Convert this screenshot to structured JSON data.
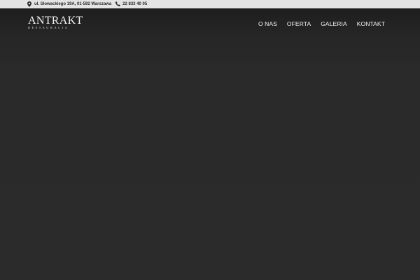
{
  "topbar": {
    "address": "ul. Słowackiego 19A, 01-592 Warszawa",
    "address_icon": "map-marker-icon",
    "phone": "22 833 40 05",
    "phone_icon": "phone-icon"
  },
  "header": {
    "logo_title": "ANTRAKT",
    "logo_subtitle": "RESTAURACJA"
  },
  "nav": {
    "items": [
      {
        "label": "O NAS"
      },
      {
        "label": "OFERTA"
      },
      {
        "label": "GALERIA"
      },
      {
        "label": "KONTAKT"
      }
    ]
  },
  "colors": {
    "topbar_bg": "#e3e3e3",
    "page_bg": "#2a2a2a",
    "text_light": "#f4f4f4",
    "text_dark": "#2b2b2b"
  }
}
